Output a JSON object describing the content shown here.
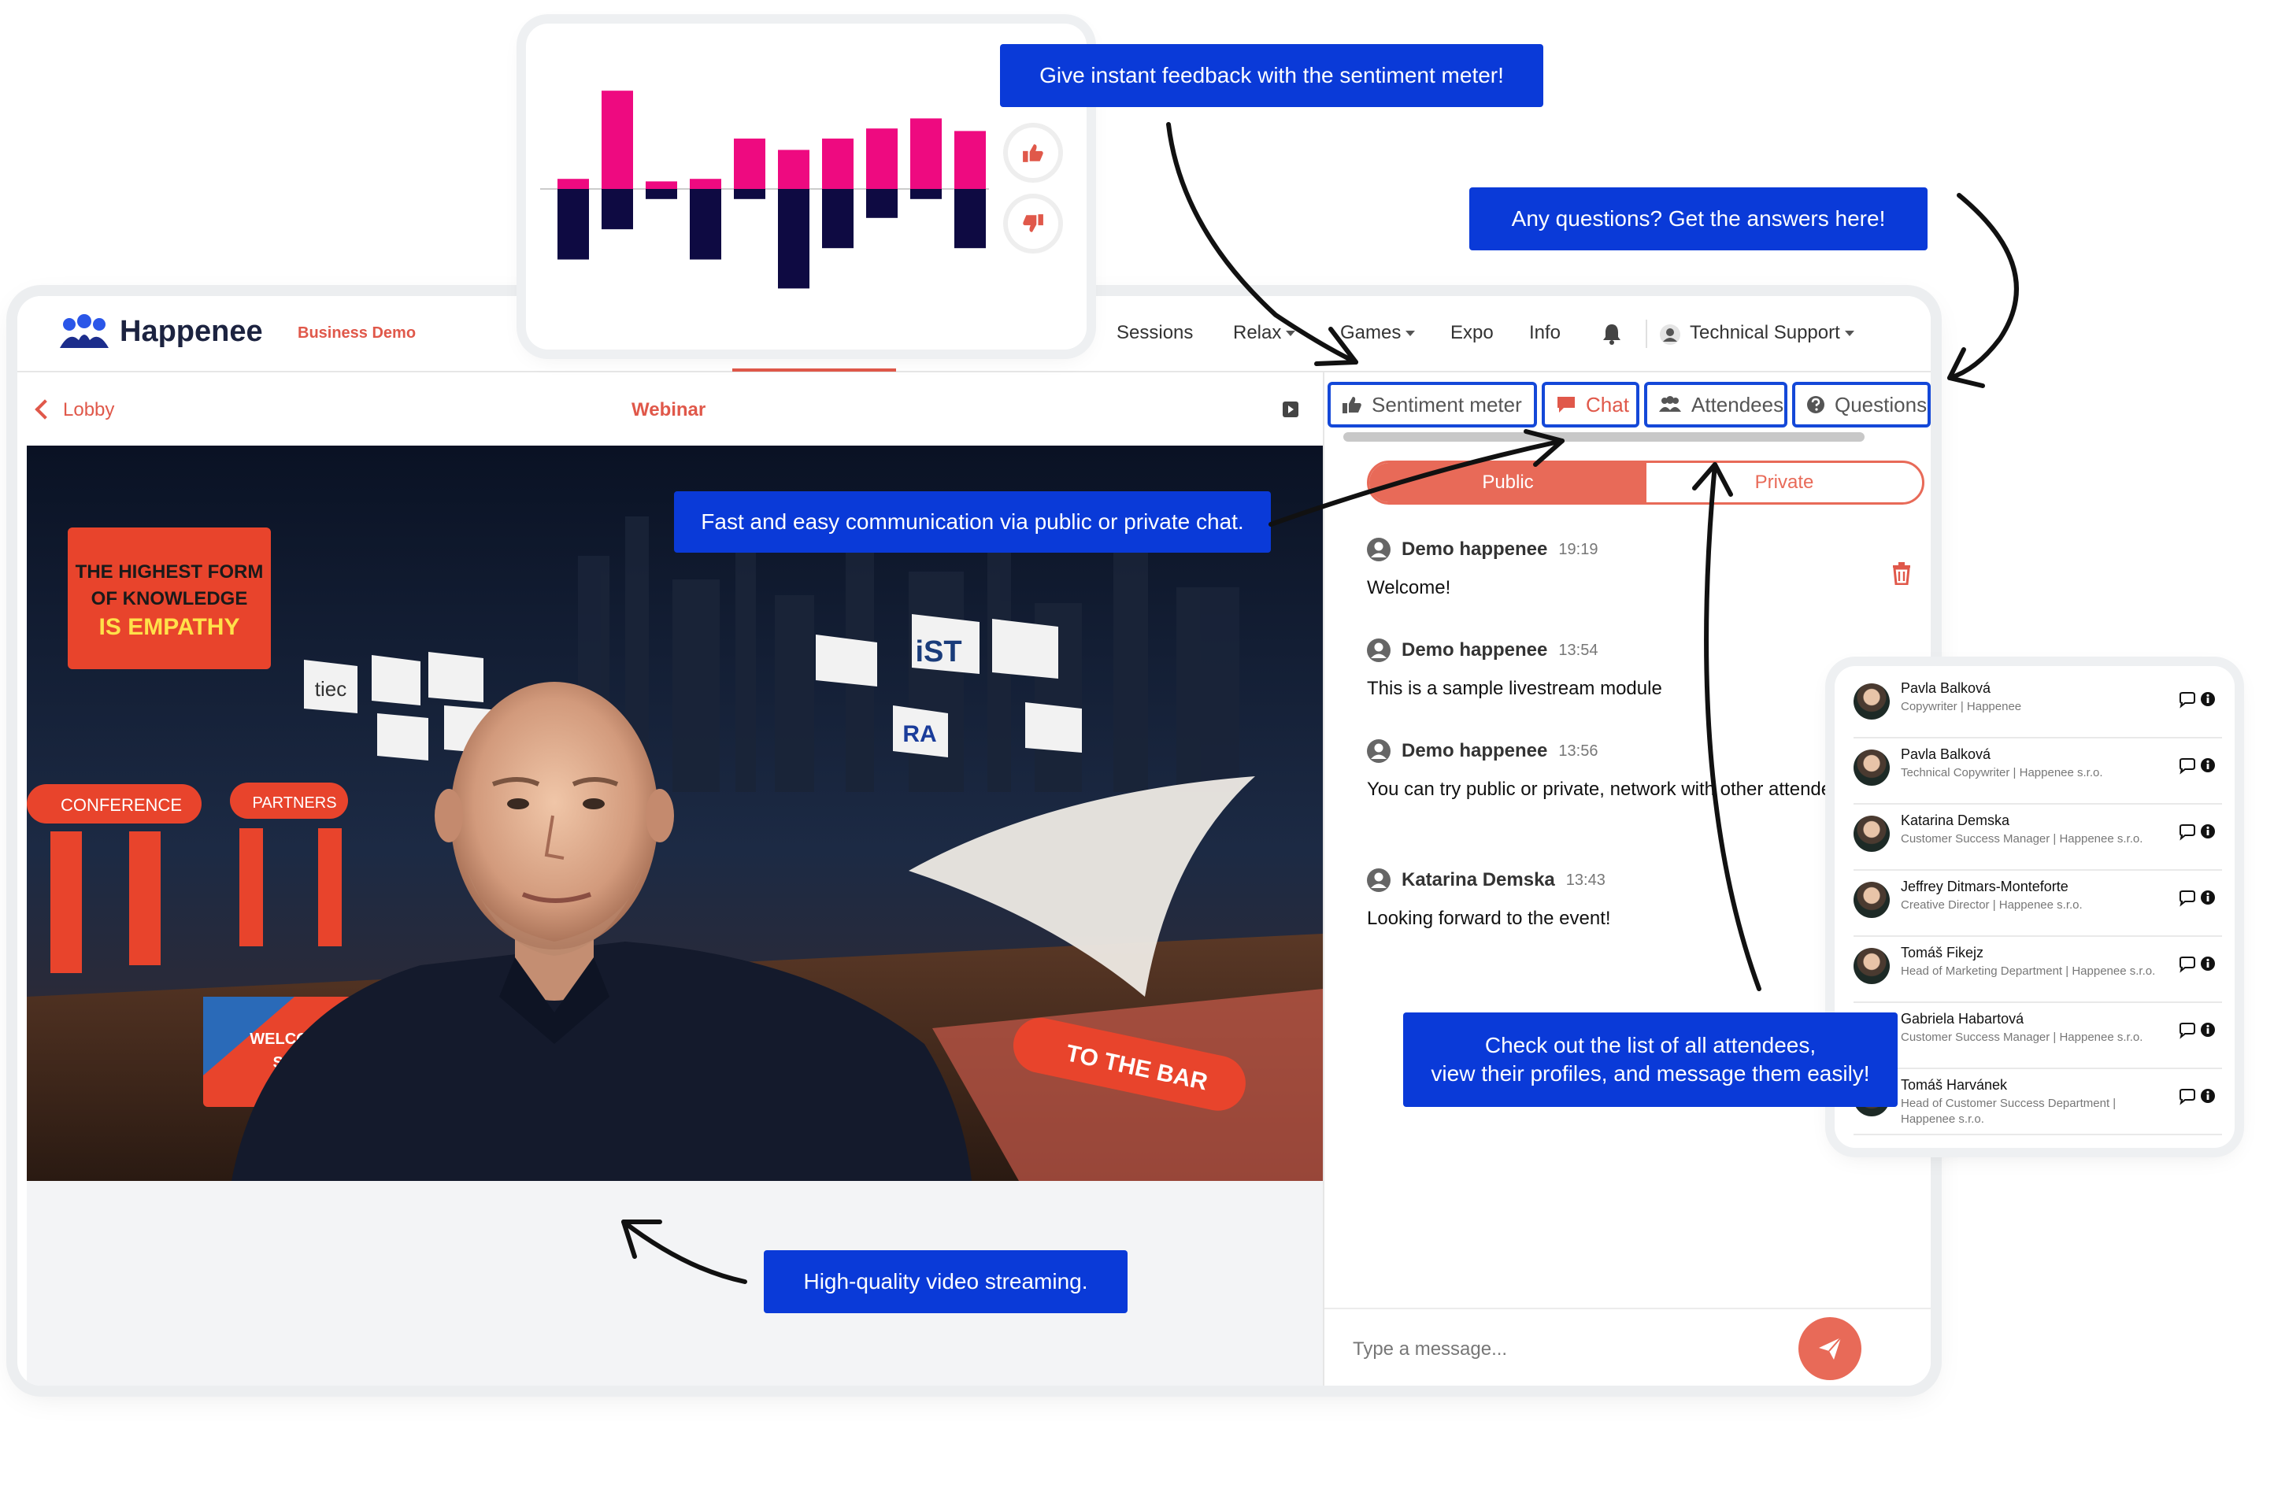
{
  "header": {
    "brand": "Happenee",
    "workspace": "Business Demo",
    "nav": [
      {
        "label": "Sessions",
        "dropdown": false
      },
      {
        "label": "Relax",
        "dropdown": true
      },
      {
        "label": "Games",
        "dropdown": true
      },
      {
        "label": "Expo",
        "dropdown": false
      },
      {
        "label": "Info",
        "dropdown": false
      }
    ],
    "user": "Technical Support"
  },
  "subbar": {
    "back_label": "Lobby",
    "title": "Webinar"
  },
  "panel": {
    "tabs": [
      {
        "label": "Sentiment meter",
        "icon": "thumbs-up-icon",
        "active": false
      },
      {
        "label": "Chat",
        "icon": "chat-bubble-icon",
        "active": true
      },
      {
        "label": "Attendees",
        "icon": "users-icon",
        "active": false
      },
      {
        "label": "Questions",
        "icon": "question-icon",
        "active": false
      }
    ],
    "toggle": {
      "public": "Public",
      "private": "Private"
    },
    "messages": [
      {
        "name": "Demo happenee",
        "time": "19:19",
        "text": "Welcome!"
      },
      {
        "name": "Demo happenee",
        "time": "13:54",
        "text": "This is a sample livestream module"
      },
      {
        "name": "Demo happenee",
        "time": "13:56",
        "text": "You can try public or private, network with other attendees, polls."
      },
      {
        "name": "Katarina Demska",
        "time": "13:43",
        "text": "Looking forward to the event!"
      }
    ],
    "composer_placeholder": "Type a message..."
  },
  "sentiment": {
    "positive": [
      8,
      78,
      6,
      8,
      40,
      31,
      40,
      48,
      56,
      46
    ],
    "negative": [
      56,
      32,
      8,
      56,
      8,
      79,
      47,
      23,
      8,
      47
    ],
    "colors": {
      "positive": "#ee0a80",
      "negative": "#0e0a42"
    }
  },
  "attendees": [
    {
      "name": "Pavla Balková",
      "role": "Copywriter | Happenee"
    },
    {
      "name": "Pavla Balková",
      "role": "Technical Copywriter | Happenee s.r.o."
    },
    {
      "name": "Katarina Demska",
      "role": "Customer Success Manager | Happenee s.r.o."
    },
    {
      "name": "Jeffrey Ditmars-Monteforte",
      "role": "Creative Director | Happenee s.r.o."
    },
    {
      "name": "Tomáš Fikejz",
      "role": "Head of Marketing Department | Happenee s.r.o."
    },
    {
      "name": "Gabriela Habartová",
      "role": "Customer Success Manager | Happenee s.r.o."
    },
    {
      "name": "Tomáš Harvánek",
      "role": "Head of Customer Success Department | Happenee s.r.o."
    }
  ],
  "callouts": {
    "sentiment": "Give instant feedback with the sentiment meter!",
    "questions": "Any questions? Get the answers here!",
    "chat": "Fast and easy communication via public or private chat.",
    "attendees_line1": "Check out the list of all attendees,",
    "attendees_line2": "view their profiles, and message them easily!",
    "video": "High-quality video streaming."
  },
  "video_scene": {
    "sign_main": [
      "THE HIGHEST FORM",
      "OF KNOWLEDGE",
      "IS EMPATHY"
    ],
    "booths": [
      "CONFERENCE",
      "PARTNERS"
    ],
    "flags": [
      "iST",
      "tiec",
      "RA"
    ],
    "bar_sign": "TO THE BAR",
    "welcome_sign": [
      "WELCOME TO",
      "SUMMIT"
    ]
  },
  "colors": {
    "accent": "#e0584a",
    "callout_blue": "#0a3ad8",
    "tab_border": "#1448d8",
    "brand_dark": "#1c2340"
  }
}
